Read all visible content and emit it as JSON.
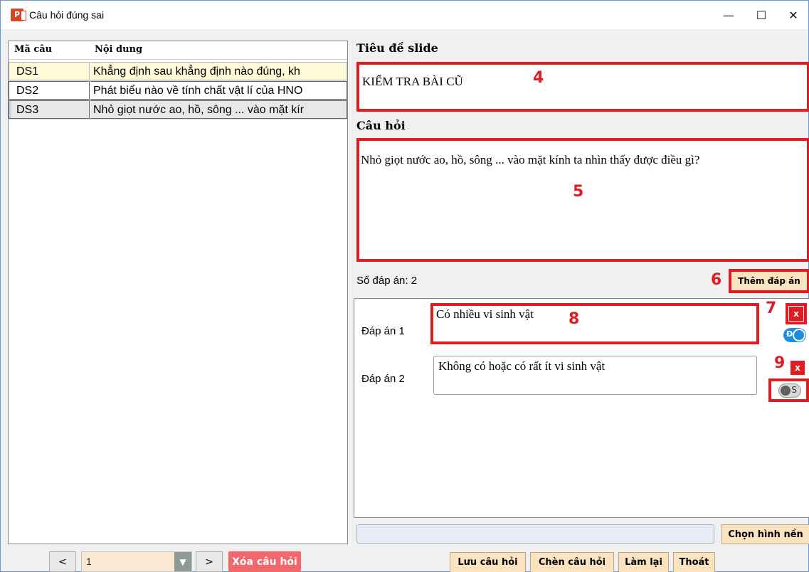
{
  "window": {
    "title": "Câu hỏi đúng sai",
    "icon_text": "P",
    "minimize": "—",
    "maximize": "☐",
    "close": "✕"
  },
  "question_list": {
    "headers": {
      "code": "Mã câu",
      "content": "Nội dung"
    },
    "rows": [
      {
        "code": "DS1",
        "content": "Khẳng định sau khẳng định nào đúng, kh"
      },
      {
        "code": "DS2",
        "content": "Phát biểu nào về tính chất vật lí của HNO"
      },
      {
        "code": "DS3",
        "content": "Nhỏ giọt nước ao, hồ, sông ... vào mặt kír"
      }
    ]
  },
  "pager": {
    "prev": "<",
    "next": ">",
    "page_value": "1",
    "delete_question": "Xóa câu hỏi"
  },
  "editor": {
    "slide_title_label": "Tiêu đề slide",
    "slide_title_value": "KIỂM TRA BÀI CŨ",
    "question_label": "Câu hỏi",
    "question_value": "Nhỏ giọt nước ao, hồ, sông ... vào mặt kính ta nhìn thấy được điều gì?",
    "answer_count_label": "Số đáp án: 2",
    "add_answer": "Thêm đáp án",
    "answers": [
      {
        "label": "Đáp án 1",
        "text": "Có nhiều vi sinh vật",
        "delete": "x",
        "toggle_letter": "Đ",
        "is_true": true
      },
      {
        "label": "Đáp án 2",
        "text": "Không có hoặc có rất ít vi sinh vật",
        "delete": "x",
        "toggle_letter": "S",
        "is_true": false
      }
    ],
    "background_path": "",
    "choose_background": "Chọn hình nền"
  },
  "actions": {
    "save": "Lưu câu hỏi",
    "insert": "Chèn câu hỏi",
    "redo": "Làm lại",
    "exit": "Thoát"
  },
  "markers": [
    "4",
    "5",
    "6",
    "7",
    "8",
    "9"
  ],
  "colors": {
    "highlight_red": "#e31b23",
    "button_peach": "#fbe3c0",
    "delete_button": "#f2676b",
    "toggle_on": "#1a8fe0"
  }
}
